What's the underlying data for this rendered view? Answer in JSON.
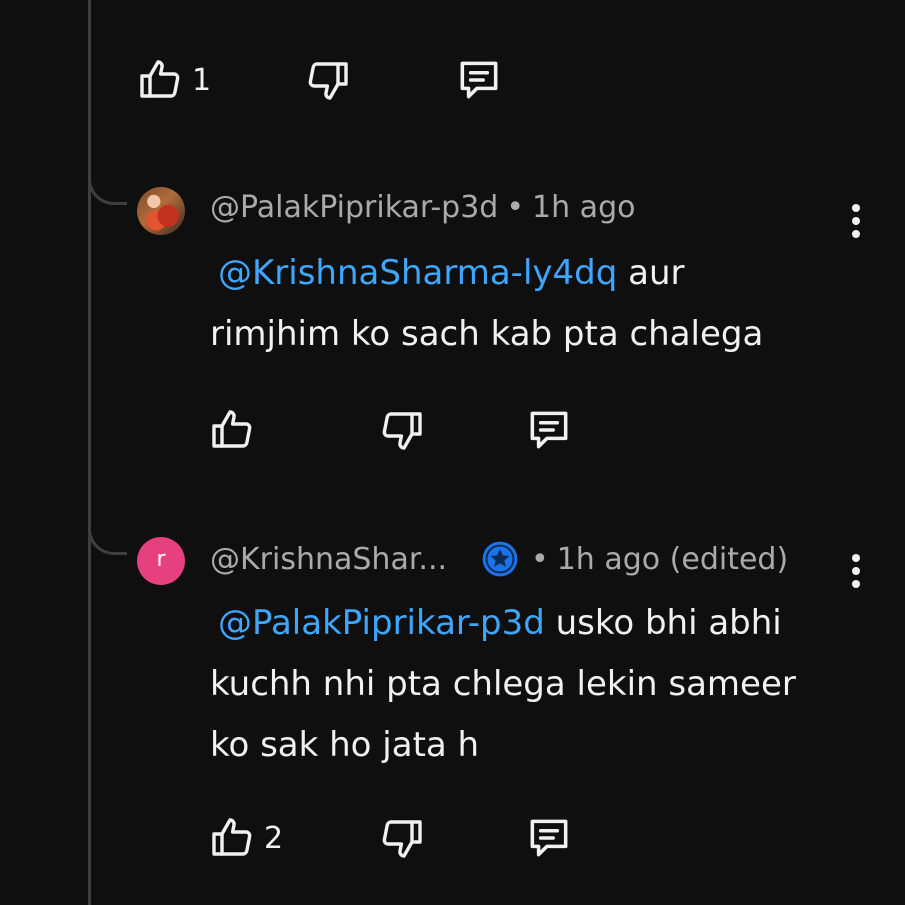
{
  "colors": {
    "background": "#0f0f0f",
    "text": "#f1f1f1",
    "muted": "#aaaaaa",
    "mention": "#3ea6ff",
    "thread_line": "#3f3f3f",
    "avatar_letter_bg": "#e6417e",
    "badge_blue": "#1a73e8"
  },
  "top_actions": {
    "like_count": "1",
    "like_icon": "thumbs-up-icon",
    "dislike_icon": "thumbs-down-icon",
    "reply_icon": "reply-comment-icon"
  },
  "comments": [
    {
      "handle": "@PalakPiprikar-p3d",
      "separator": "•",
      "time": "1h ago",
      "mention": "@KrishnaSharma-ly4dq",
      "text": " aur rimjhim ko sach kab pta chalega",
      "like_count": "",
      "menu_icon": "more-vert-icon"
    },
    {
      "avatar_letter": "r",
      "handle": "@KrishnaShar...",
      "badge_icon": "channel-member-star-badge-icon",
      "separator": "•",
      "time": "1h ago (edited)",
      "mention": "@PalakPiprikar-p3d",
      "text": " usko bhi abhi kuchh nhi pta chlega lekin sameer ko sak ho jata h",
      "like_count": "2",
      "menu_icon": "more-vert-icon"
    }
  ]
}
